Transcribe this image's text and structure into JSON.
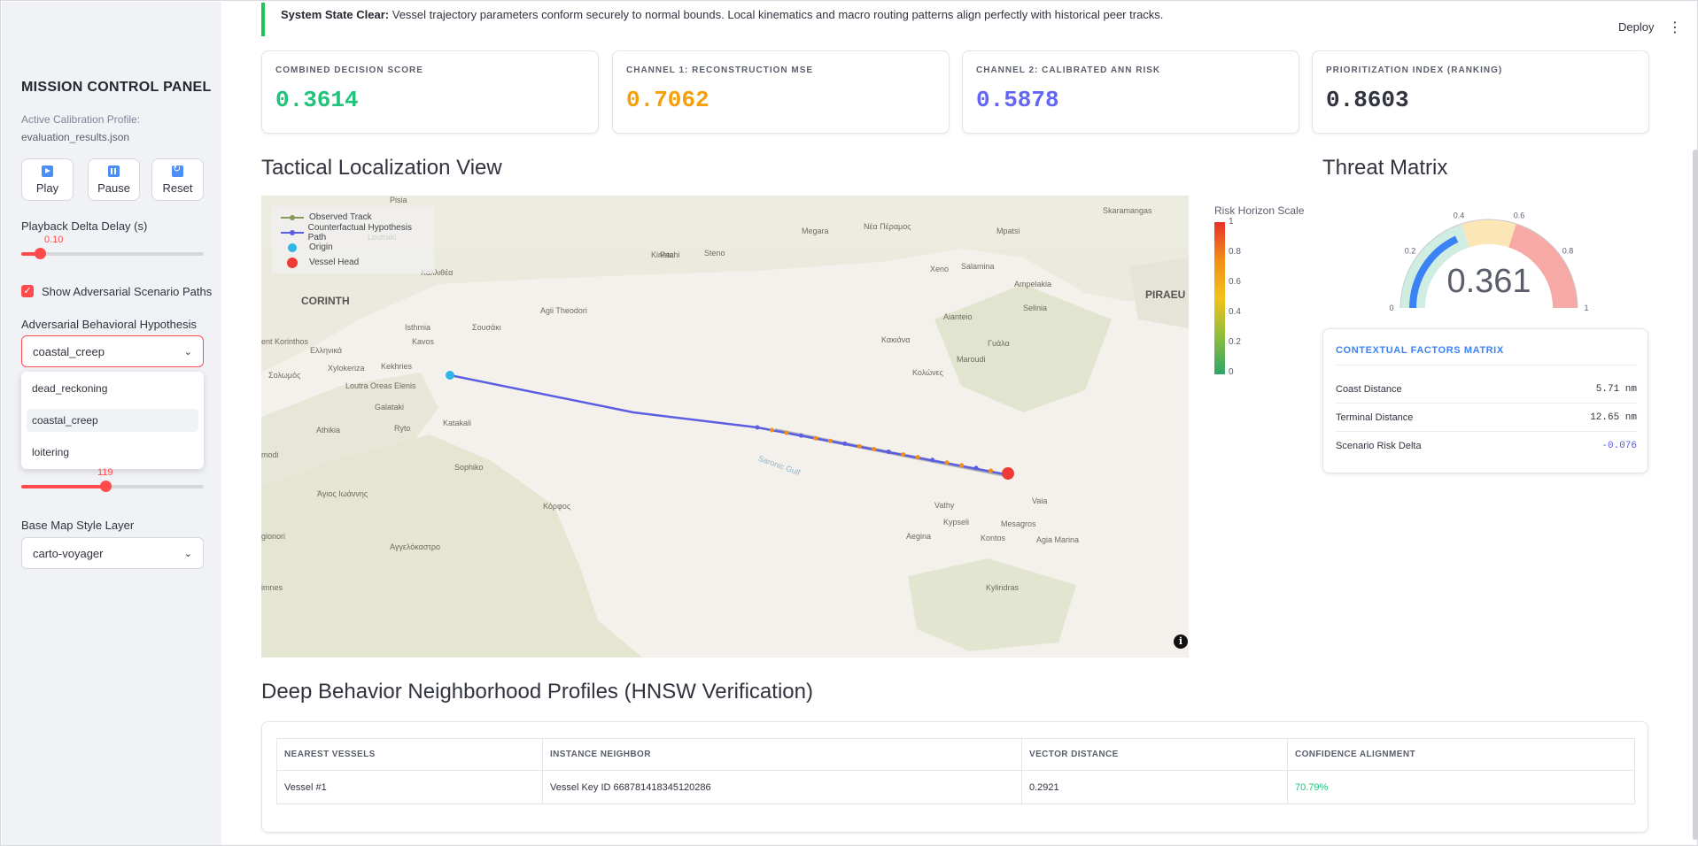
{
  "sidebar": {
    "title": "MISSION CONTROL PANEL",
    "profile_label": "Active Calibration Profile:",
    "profile_file": "evaluation_results.json",
    "buttons": [
      {
        "label": "Play",
        "icon": "play-icon"
      },
      {
        "label": "Pause",
        "icon": "pause-icon"
      },
      {
        "label": "Reset",
        "icon": "reset-icon"
      }
    ],
    "delay_label": "Playback Delta Delay (s)",
    "delay_value": "0.10",
    "delay_fraction": 0.1,
    "adv_paths_label": "Show Adversarial Scenario Paths",
    "adv_paths_checked": true,
    "hypothesis_label": "Adversarial Behavioral Hypothesis",
    "hypothesis_value": "coastal_creep",
    "hypothesis_options": [
      "dead_reckoning",
      "coastal_creep",
      "loitering"
    ],
    "second_slider_value": "119",
    "second_slider_fraction": 0.46,
    "map_style_label": "Base Map Style Layer",
    "map_style_value": "carto-voyager"
  },
  "banner": {
    "bold": "System State Clear:",
    "text": " Vessel trajectory parameters conform securely to normal bounds. Local kinematics and macro routing patterns align perfectly with historical peer tracks."
  },
  "toolbar": {
    "deploy": "Deploy",
    "menu": "⋮"
  },
  "kpis": [
    {
      "label": "COMBINED DECISION SCORE",
      "value": "0.3614",
      "color": "#21c37a"
    },
    {
      "label": "CHANNEL 1: RECONSTRUCTION MSE",
      "value": "0.7062",
      "color": "#f5a00b"
    },
    {
      "label": "CHANNEL 2: CALIBRATED ANN RISK",
      "value": "0.5878",
      "color": "#6366f1"
    },
    {
      "label": "PRIORITIZATION INDEX (RANKING)",
      "value": "0.8603",
      "color": "#31333f"
    }
  ],
  "map_section": {
    "title": "Tactical Localization View",
    "legend": [
      "Observed Track",
      "Counterfactual Hypothesis Path",
      "Origin",
      "Vessel Head"
    ],
    "colorbar_title": "Risk Horizon Scale",
    "colorbar_ticks": [
      "1",
      "0.8",
      "0.6",
      "0.4",
      "0.2",
      "0"
    ],
    "places": [
      "Pisia",
      "Megara",
      "Νέα Πέραμος",
      "Mpatsi",
      "Skaramangas",
      "Loutraki",
      "Kineta",
      "Pachi",
      "Steno",
      "Salamina",
      "Ampelakia",
      "PIRAEU",
      "CORINTH",
      "Καλλιθέα",
      "Xeno",
      "Selinia",
      "Agii Theodori",
      "Aianteio",
      "Isthmia",
      "Σουσάκι",
      "Kavos",
      "Κακιάνα",
      "Γυάλα",
      "ent Korinthos",
      "Ελληνικά",
      "Maroudi",
      "Xylokeriza",
      "Kekhries",
      "Κολώνες",
      "Σολωμός",
      "Loutra Oreas Elenis",
      "Galataki",
      "Katakali",
      "Athikia",
      "Ryto",
      "modi",
      "Sophiko",
      "Άγιος Ιωάννης",
      "Κόρφος",
      "Vathy",
      "Vaia",
      "Kypseli",
      "Mesagros",
      "Aegina",
      "Kontos",
      "Agia Marina",
      "gionori",
      "Αγγελόκαστρο",
      "Kylindras",
      "imnes",
      "Saronic Gulf"
    ]
  },
  "threat": {
    "title": "Threat Matrix",
    "gauge_value": "0.361",
    "gauge_fraction": 0.361,
    "gauge_ticks": [
      "0",
      "0.2",
      "0.4",
      "0.6",
      "0.8",
      "1"
    ],
    "ctx_title": "CONTEXTUAL FACTORS MATRIX",
    "rows": [
      {
        "label": "Coast Distance",
        "value": "5.71 nm",
        "color": "#31333f"
      },
      {
        "label": "Terminal Distance",
        "value": "12.65 nm",
        "color": "#31333f"
      },
      {
        "label": "Scenario Risk Delta",
        "value": "-0.076",
        "color": "#5b5ee0"
      }
    ]
  },
  "neighbors": {
    "title": "Deep Behavior Neighborhood Profiles (HNSW Verification)",
    "headers": [
      "NEAREST VESSELS",
      "INSTANCE NEIGHBOR",
      "VECTOR DISTANCE",
      "CONFIDENCE ALIGNMENT"
    ],
    "rows": [
      [
        "Vessel #1",
        "Vessel Key ID 668781418345120286",
        "0.2921",
        "70.79%"
      ]
    ]
  },
  "colors": {
    "accent": "#ff4b4b",
    "success": "#21c354",
    "info": "#3b82f6"
  }
}
